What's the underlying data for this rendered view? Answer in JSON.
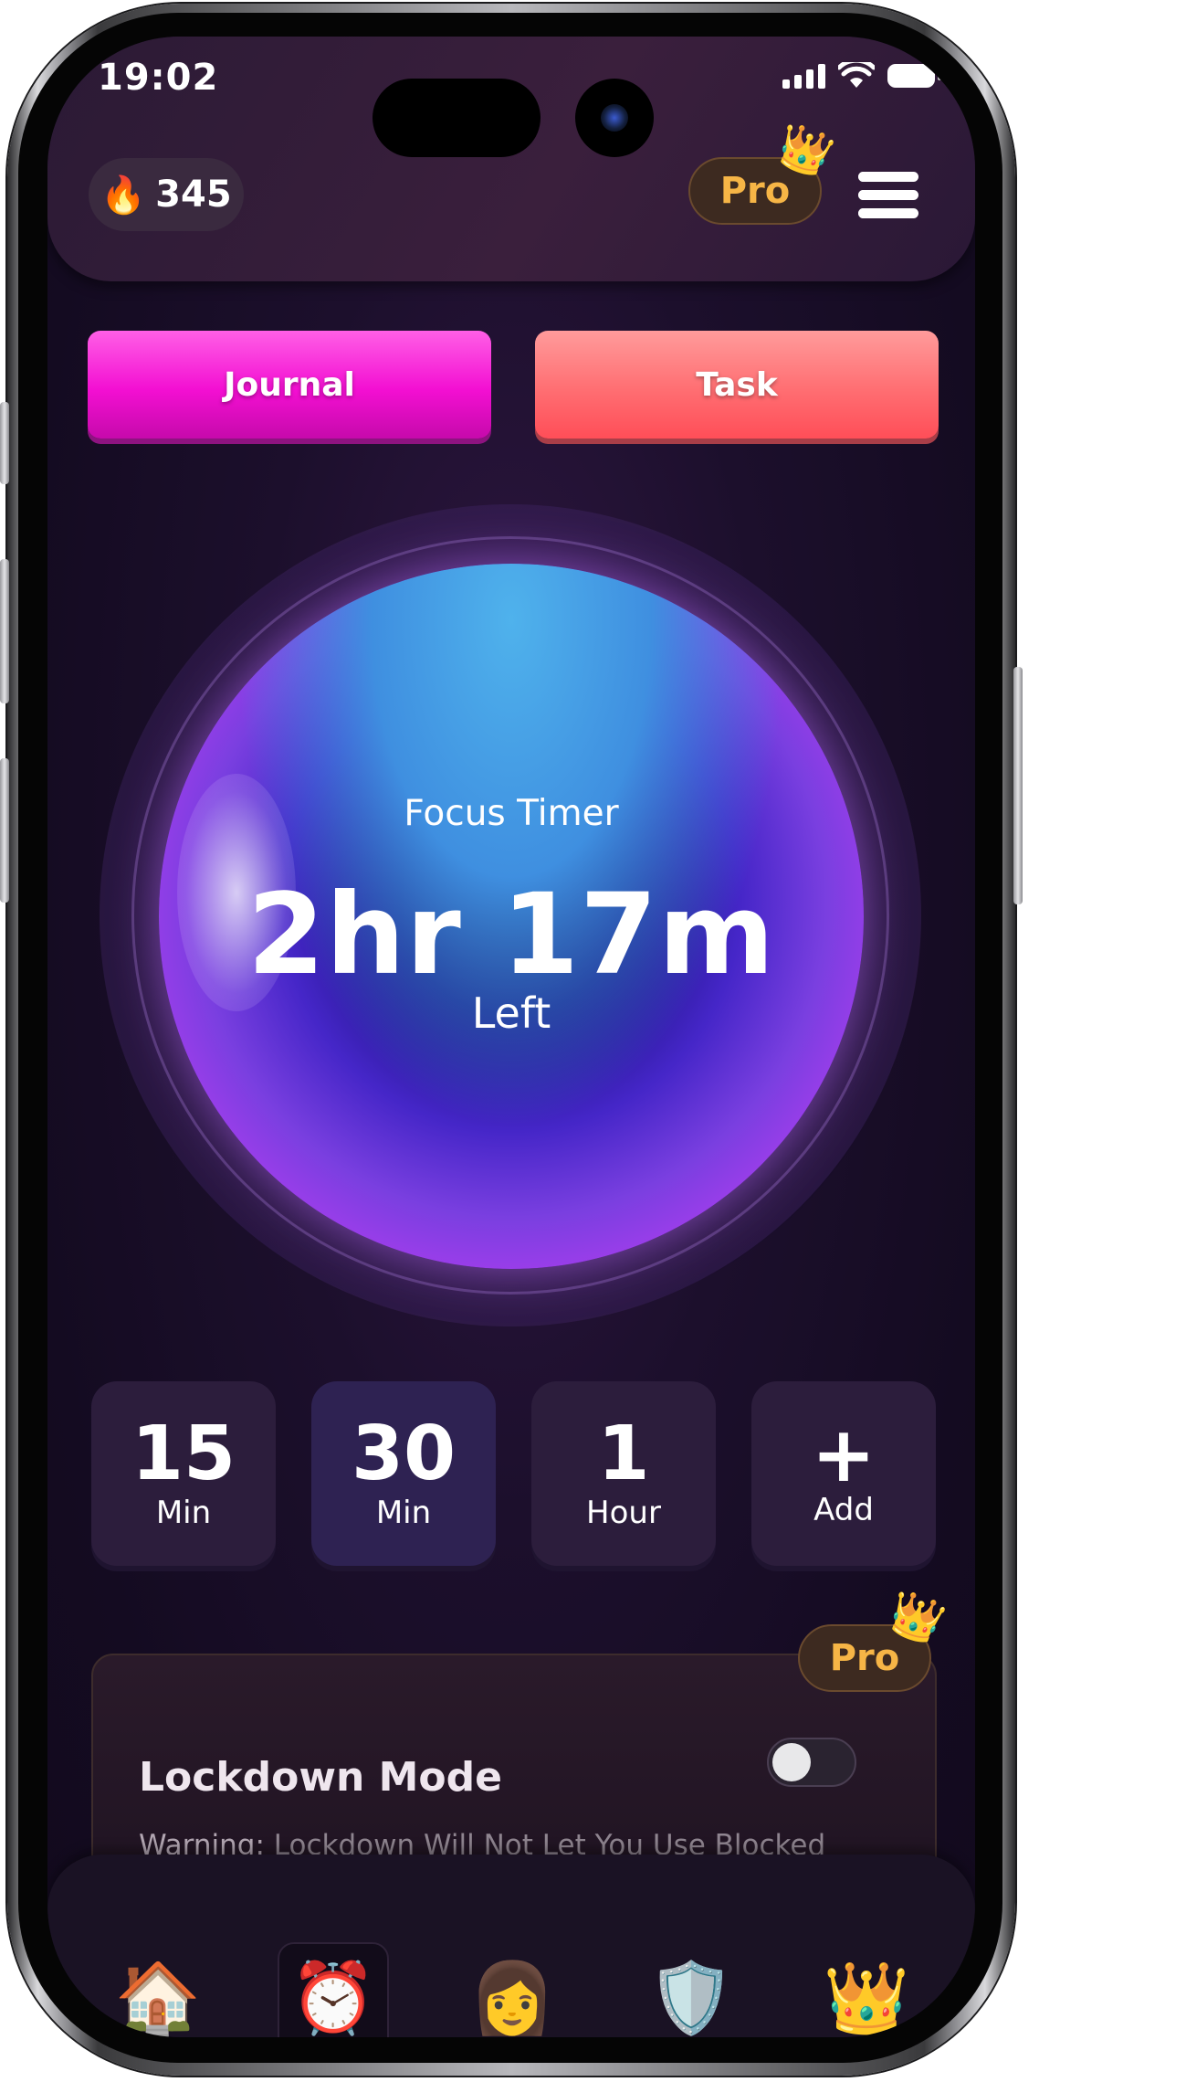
{
  "status_bar": {
    "time": "19:02"
  },
  "header": {
    "streak_count": "345",
    "pro_label": "Pro"
  },
  "actions": {
    "journal_label": "Journal",
    "task_label": "Task"
  },
  "timer": {
    "title": "Focus Timer",
    "remaining": "2hr 17m",
    "suffix": "Left"
  },
  "presets": [
    {
      "value": "15",
      "unit": "Min"
    },
    {
      "value": "30",
      "unit": "Min"
    },
    {
      "value": "1",
      "unit": "Hour"
    },
    {
      "value": "+",
      "unit": "Add"
    }
  ],
  "lockdown": {
    "pro_label": "Pro",
    "title": "Lockdown Mode",
    "enabled": false,
    "warning_label": "Warning:",
    "warning_text": "Lockdown Will Not Let You Use Blocked"
  },
  "tabs": [
    {
      "icon": "home-icon"
    },
    {
      "icon": "alarm-clock-icon",
      "active": true
    },
    {
      "icon": "profile-icon"
    },
    {
      "icon": "shield-icon"
    },
    {
      "icon": "crown-icon"
    }
  ],
  "colors": {
    "journal": "#f30fd2",
    "task": "#ff6e72",
    "pro_text": "#f6b546",
    "background": "#1c0f2c"
  }
}
